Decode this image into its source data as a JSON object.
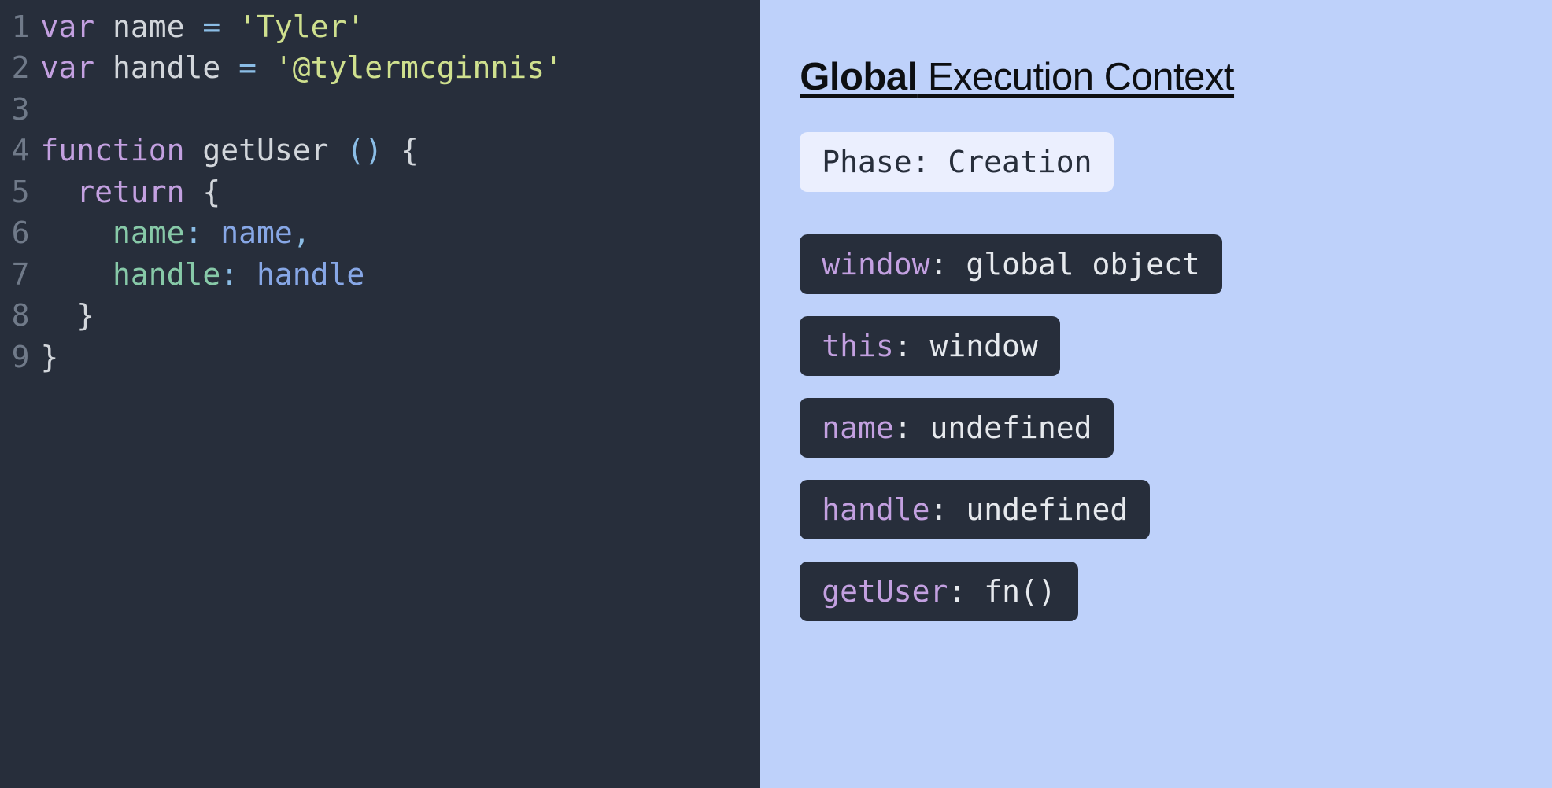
{
  "code_lines": [
    {
      "n": "1",
      "tokens": [
        [
          "kw",
          "var"
        ],
        [
          "fn",
          " name "
        ],
        [
          "op",
          "= "
        ],
        [
          "str",
          "'Tyler'"
        ]
      ]
    },
    {
      "n": "2",
      "tokens": [
        [
          "kw",
          "var"
        ],
        [
          "fn",
          " handle "
        ],
        [
          "op",
          "= "
        ],
        [
          "str",
          "'@tylermcginnis'"
        ]
      ]
    },
    {
      "n": "3",
      "tokens": []
    },
    {
      "n": "4",
      "tokens": [
        [
          "kw",
          "function"
        ],
        [
          "fn",
          " getUser "
        ],
        [
          "op",
          "()"
        ],
        [
          "fn",
          " {"
        ]
      ]
    },
    {
      "n": "5",
      "tokens": [
        [
          "fn",
          "  "
        ],
        [
          "kw",
          "return"
        ],
        [
          "fn",
          " {"
        ]
      ]
    },
    {
      "n": "6",
      "tokens": [
        [
          "fn",
          "    "
        ],
        [
          "prop",
          "name"
        ],
        [
          "op",
          ": "
        ],
        [
          "ref",
          "name"
        ],
        [
          "op",
          ","
        ]
      ]
    },
    {
      "n": "7",
      "tokens": [
        [
          "fn",
          "    "
        ],
        [
          "prop",
          "handle"
        ],
        [
          "op",
          ": "
        ],
        [
          "ref",
          "handle"
        ]
      ]
    },
    {
      "n": "8",
      "tokens": [
        [
          "fn",
          "  }"
        ]
      ]
    },
    {
      "n": "9",
      "tokens": [
        [
          "fn",
          "}"
        ]
      ]
    }
  ],
  "context": {
    "title_bold": "Global",
    "title_rest": " Execution Context",
    "phase_label": "Phase: ",
    "phase_value": "Creation",
    "bindings": [
      {
        "key": "window",
        "val": "global object"
      },
      {
        "key": "this",
        "val": "window"
      },
      {
        "key": "name",
        "val": "undefined"
      },
      {
        "key": "handle",
        "val": "undefined"
      },
      {
        "key": "getUser",
        "val": "fn()"
      }
    ]
  }
}
